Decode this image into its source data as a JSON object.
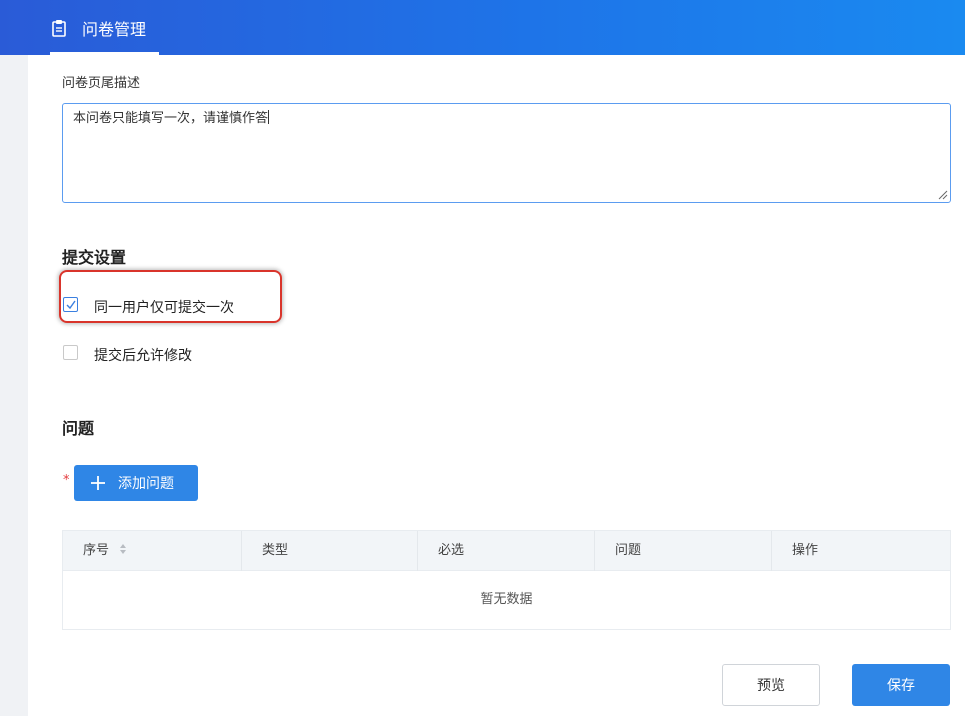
{
  "header": {
    "tab_label": "问卷管理",
    "tab_icon": "clipboard-icon",
    "gradient_start": "#2a5bd7",
    "gradient_end": "#1a8af0"
  },
  "footer_desc": {
    "label": "问卷页尾描述",
    "value": "本问卷只能填写一次，请谨慎作答"
  },
  "submit_settings": {
    "title": "提交设置",
    "options": [
      {
        "label": "同一用户仅可提交一次",
        "checked": true
      },
      {
        "label": "提交后允许修改",
        "checked": false
      }
    ]
  },
  "questions": {
    "title": "问题",
    "required_mark": "*",
    "add_button_label": "添加问题",
    "table": {
      "columns": [
        "序号",
        "类型",
        "必选",
        "问题",
        "操作"
      ],
      "empty_text": "暂无数据"
    }
  },
  "actions": {
    "preview_label": "预览",
    "save_label": "保存",
    "accent": "#2f86e6"
  }
}
